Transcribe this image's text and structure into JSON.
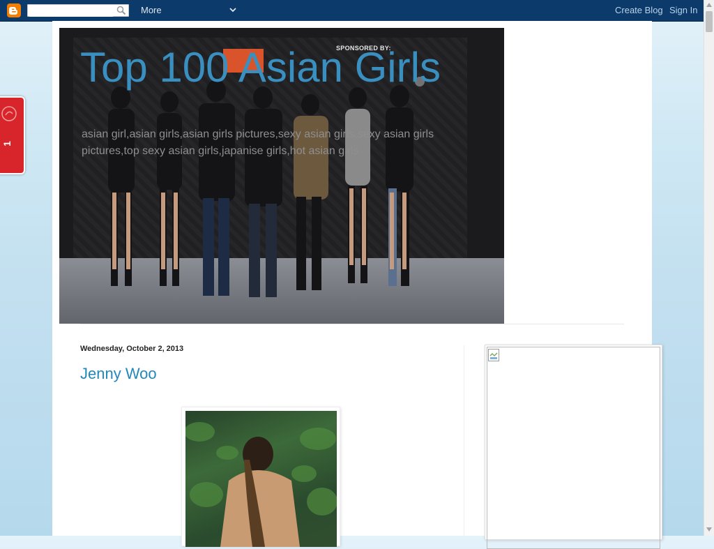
{
  "navbar": {
    "search_placeholder": "",
    "more_label": "More",
    "create_blog": "Create Blog",
    "sign_in": "Sign In"
  },
  "side_tab": {
    "number": "1"
  },
  "header": {
    "title": "Top 100 Asian Girls",
    "description": "asian girl,asian girls,asian girls pictures,sexy asian girls,sexy asian girls pictures,top sexy asian girls,japanise girls,hot asian girls",
    "sponsor_text": "SPONSORED BY:"
  },
  "post": {
    "date": "Wednesday, October 2, 2013",
    "title": "Jenny Woo"
  },
  "colors": {
    "navbar": "#0b3a6b",
    "title": "#3a8fc1",
    "link": "#2288bb",
    "blogger_orange": "#f57d00"
  }
}
